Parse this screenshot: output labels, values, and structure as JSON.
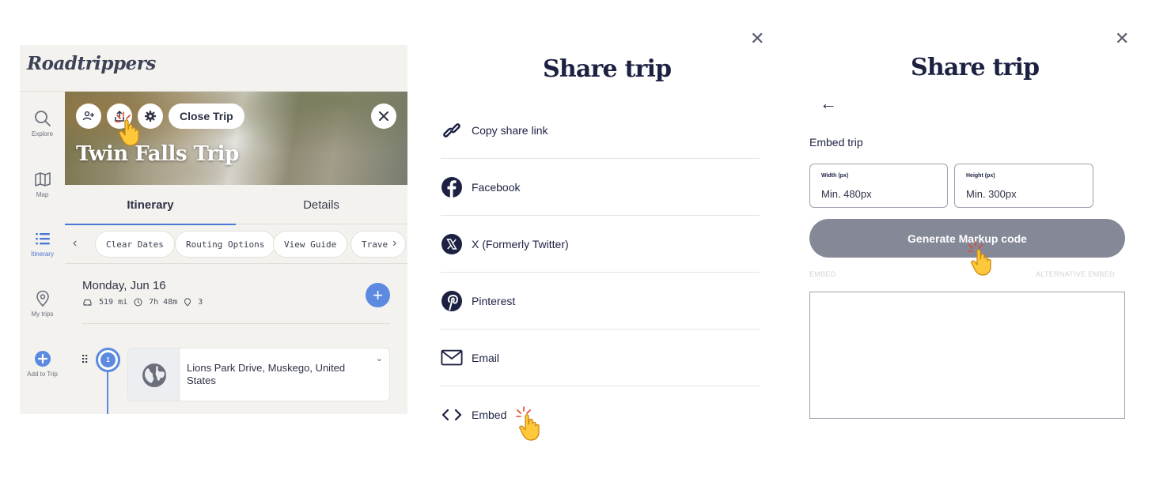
{
  "app": {
    "logo": "Roadtrippers",
    "sidebar": [
      {
        "label": "Explore",
        "icon": "search-icon"
      },
      {
        "label": "Map",
        "icon": "map-icon"
      },
      {
        "label": "Itinerary",
        "icon": "list-icon",
        "active": true
      },
      {
        "label": "My trips",
        "icon": "location-pin-icon"
      },
      {
        "label": "Add to Trip",
        "icon": "plus-circle-icon"
      }
    ],
    "hero": {
      "close_trip_label": "Close Trip",
      "trip_title": "Twin Falls Trip"
    },
    "tabs": [
      {
        "label": "Itinerary",
        "active": true
      },
      {
        "label": "Details",
        "active": false
      }
    ],
    "chips": [
      "Clear Dates",
      "Routing Options",
      "View Guide",
      "Trave"
    ],
    "day": {
      "title": "Monday, Jun 16",
      "distance": "519 mi",
      "duration": "7h 48m",
      "stops": "3"
    },
    "stop": {
      "number": "1",
      "address": "Lions Park Drive, Muskego, United States"
    }
  },
  "share_panel": {
    "title": "Share trip",
    "options": [
      {
        "label": "Copy share link",
        "icon": "link-icon"
      },
      {
        "label": "Facebook",
        "icon": "facebook-icon"
      },
      {
        "label": "X (Formerly Twitter)",
        "icon": "x-twitter-icon"
      },
      {
        "label": "Pinterest",
        "icon": "pinterest-icon"
      },
      {
        "label": "Email",
        "icon": "email-icon"
      },
      {
        "label": "Embed",
        "icon": "code-icon"
      }
    ]
  },
  "embed_panel": {
    "title": "Share trip",
    "section_label": "Embed trip",
    "width_label": "Width (px)",
    "width_placeholder": "Min. 480px",
    "height_label": "Height (px)",
    "height_placeholder": "Min. 300px",
    "generate_button": "Generate Markup code",
    "tab_embed": "EMBED",
    "tab_alternative": "ALTERNATIVE EMBED",
    "code_value": ""
  },
  "colors": {
    "accent": "#5b8ae0",
    "navy": "#1c2142",
    "button_gray": "#858896",
    "app_bg": "#f3f2ee"
  }
}
